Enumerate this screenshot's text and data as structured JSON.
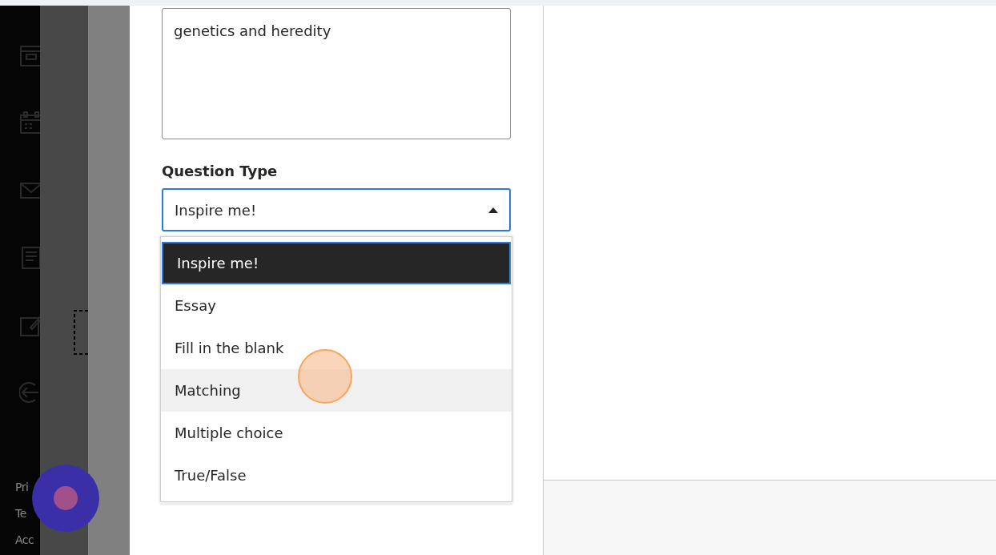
{
  "topic_field": {
    "value": "genetics and heredity"
  },
  "question_type": {
    "label": "Question Type",
    "value": "Inspire me!",
    "expanded": true,
    "options": [
      {
        "label": "Inspire me!",
        "selected": true,
        "hovered": false
      },
      {
        "label": "Essay",
        "selected": false,
        "hovered": false
      },
      {
        "label": "Fill in the blank",
        "selected": false,
        "hovered": false
      },
      {
        "label": "Matching",
        "selected": false,
        "hovered": true
      },
      {
        "label": "Multiple choice",
        "selected": false,
        "hovered": false
      },
      {
        "label": "True/False",
        "selected": false,
        "hovered": false
      }
    ]
  },
  "nav_footer_links": [
    "Pri",
    "Te",
    "Acc"
  ]
}
